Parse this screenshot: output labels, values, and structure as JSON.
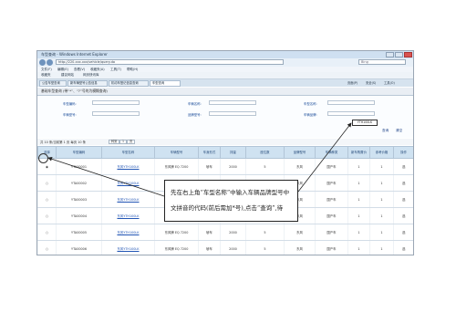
{
  "window": {
    "title": "车型查询 - Windows Internet Explorer",
    "url": "http://220.xxx.xxx/vehicle/query.do",
    "search_placeholder": "Bing"
  },
  "menu": [
    "文件(F)",
    "编辑(E)",
    "查看(V)",
    "收藏夹(A)",
    "工具(T)",
    "帮助(H)"
  ],
  "favorites": [
    "收藏夹",
    "建议网站",
    "网页快讯库"
  ],
  "tabs": [
    {
      "label": "公告车型查询"
    },
    {
      "label": "新车辆型号公告信息"
    },
    {
      "label": "机动车登记信息查询"
    },
    {
      "label": "车型查询"
    }
  ],
  "tools": [
    "页面(P)",
    "安全(S)",
    "工具(O)"
  ],
  "page_header": "基础车型查询 (带“*”、“?”号的为模糊查询)",
  "form": {
    "labels": [
      "车型编码:",
      "车辆名称:",
      "车型名称:",
      "车辆型号:",
      "品牌型号:",
      "车辆品牌:"
    ],
    "brand_value": "YTH100LK",
    "search_btn": "查询",
    "reset_btn": "清空"
  },
  "list_header": "共 10 条/当前第 1 页 每页 10 条",
  "pager": [
    "转到",
    "1",
    "页"
  ],
  "table": {
    "columns": [
      "选择",
      "车型编码",
      "车型名称",
      "车辆型号",
      "车身形式",
      "排量",
      "座位数",
      "品牌型号",
      "车辆种类",
      "新车购置价",
      "参考价格",
      "操作"
    ],
    "rows": [
      [
        "◉",
        "YTA00001",
        "东风YTH100LK",
        "东风牌 EQ 7200",
        "轿车",
        "2000",
        "5",
        "东风",
        "国产车",
        "1",
        "1",
        "选"
      ],
      [
        "○",
        "YTA00002",
        "东风YTH100LK",
        "东风牌 EQ 7200",
        "轿车",
        "2000",
        "5",
        "东风",
        "国产车",
        "1",
        "1",
        "选"
      ],
      [
        "○",
        "YTA00003",
        "东风YTH100LK",
        "东风牌 EQ 7200",
        "轿车",
        "2000",
        "5",
        "东风",
        "国产车",
        "1",
        "1",
        "选"
      ],
      [
        "○",
        "YTA00004",
        "东风YTH100LK",
        "东风牌 EQ 7200",
        "轿车",
        "2000",
        "5",
        "东风",
        "国产车",
        "1",
        "1",
        "选"
      ],
      [
        "○",
        "YTA00005",
        "东风YTH100LK",
        "东风牌 EQ 7200",
        "轿车",
        "2000",
        "5",
        "东风",
        "国产车",
        "1",
        "1",
        "选"
      ],
      [
        "○",
        "YTA00006",
        "东风YTH100LK",
        "东风牌 EQ 7200",
        "轿车",
        "2000",
        "5",
        "东风",
        "国产车",
        "1",
        "1",
        "选"
      ]
    ]
  },
  "callout": {
    "line1": "先在右上角“车型名称”中输入车辆品牌型号中",
    "line2": "文拼音的代码(前后需加*号),点击“查询”,待"
  },
  "colors": {
    "accent": "#cfe2f1",
    "link": "#2356b5"
  }
}
